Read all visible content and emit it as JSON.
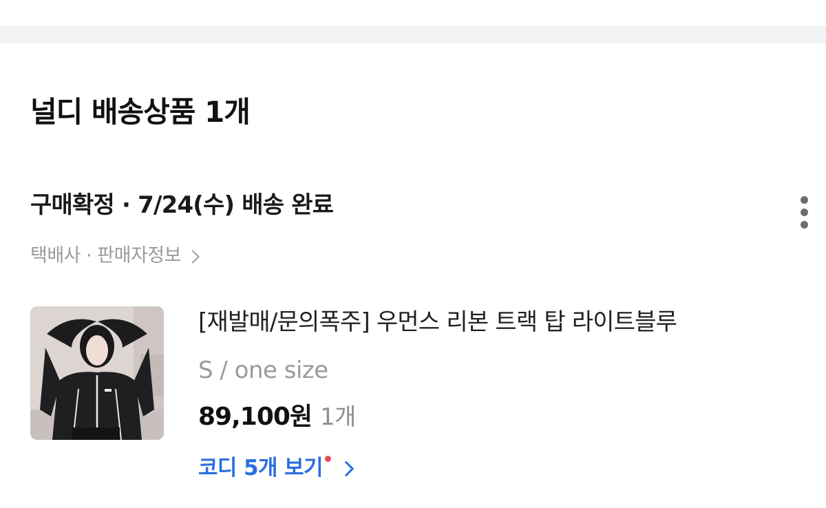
{
  "colors": {
    "link": "#2a6fe0",
    "new_badge": "#ee4a5a",
    "muted_text": "#9a9a9e",
    "divider": "#f2f2f4"
  },
  "shipment": {
    "title": "널디 배송상품 1개",
    "status": "구매확정 · 7/24(수) 배송 완료",
    "seller_link": "택배사 · 판매자정보",
    "more_icon": "more-vertical-icon"
  },
  "product": {
    "name": "[재발매/문의폭주] 우먼스 리본 트랙 탑 라이트블루",
    "option": "S / one size",
    "price": "89,100원",
    "quantity": "1개",
    "thumbnail_icon": "product-photo"
  },
  "codi": {
    "label": "코디 5개 보기",
    "has_new": true
  }
}
